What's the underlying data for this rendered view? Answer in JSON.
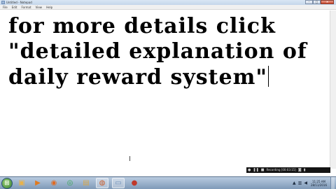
{
  "window": {
    "title": "Untitled - Notepad",
    "buttons": {
      "minimize": "–",
      "maximize": "□",
      "close": "✕"
    }
  },
  "menu": {
    "items": [
      "File",
      "Edit",
      "Format",
      "View",
      "Help"
    ]
  },
  "editor": {
    "lines": [
      "for more details click",
      "\"detailed explanation of",
      "daily reward system\""
    ],
    "pointer_glyph": "I"
  },
  "recording": {
    "text": "Recording [00:03:15]"
  },
  "taskbar": {
    "start_glyph": "⊞",
    "icons": [
      {
        "name": "windows-explorer-icon",
        "glyph": "▣",
        "color": "#e8b24a"
      },
      {
        "name": "media-player-icon",
        "glyph": "▶",
        "color": "#e07a1f"
      },
      {
        "name": "firefox-icon",
        "glyph": "◉",
        "color": "#e06a22"
      },
      {
        "name": "chrome-icon",
        "glyph": "◎",
        "color": "#3aa757"
      },
      {
        "name": "folder-icon",
        "glyph": "▤",
        "color": "#d7a64a"
      },
      {
        "name": "browser-icon",
        "glyph": "◍",
        "color": "#c65a2a"
      },
      {
        "name": "notepad-icon",
        "glyph": "▭",
        "color": "#6f8fb8"
      },
      {
        "name": "recorder-icon",
        "glyph": "●",
        "color": "#c0392b"
      }
    ],
    "tray": {
      "icons": [
        {
          "name": "arrow-up-icon",
          "glyph": "▲"
        },
        {
          "name": "network-icon",
          "glyph": "▥"
        },
        {
          "name": "volume-icon",
          "glyph": "◀"
        }
      ],
      "time": "11:25 AM",
      "date": "28/11/2016"
    }
  }
}
